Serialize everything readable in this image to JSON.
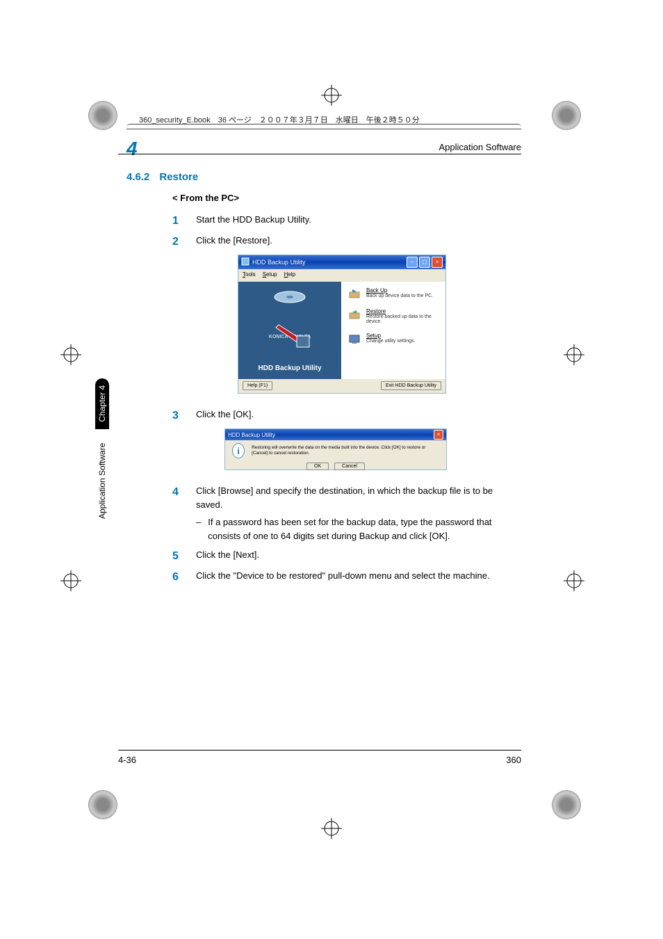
{
  "crop_header": "360_security_E.book　36 ページ　２００７年３月７日　水曜日　午後２時５０分",
  "running_head": {
    "section_number": "4",
    "title": "Application Software"
  },
  "heading": {
    "number": "4.6.2",
    "title": "Restore"
  },
  "subheading": "< From the PC>",
  "steps": {
    "1": "Start the HDD Backup Utility.",
    "2": "Click the [Restore].",
    "3": "Click the [OK].",
    "4": "Click [Browse] and specify the destination, in which the backup file is to be saved.",
    "4_sub": "If a password has been set for the backup data, type the password that consists of one to 64 digits set during Backup and click [OK].",
    "5": "Click the [Next].",
    "6": "Click the \"Device to be restored\" pull-down menu and select the machine."
  },
  "figure1": {
    "title": "HDD Backup Utility",
    "menu": {
      "tools": "Tools",
      "setup": "Setup",
      "help": "Help"
    },
    "logo": "KONICA MINOLTA",
    "utility_label": "HDD Backup Utility",
    "options": {
      "backup": {
        "title": "Back Up",
        "desc": "Back up device data to the PC."
      },
      "restore": {
        "title": "Restore",
        "desc": "Restore backed up data to the device."
      },
      "setup": {
        "title": "Setup",
        "desc": "Change utility settings."
      }
    },
    "buttons": {
      "help": "Help (F1)",
      "exit": "Exit HDD Backup Utility"
    }
  },
  "figure2": {
    "title": "HDD Backup Utility",
    "message": "Restoring will overwrite the data on the media built into the device. Click [OK] to restore or [Cancel] to cancel restoration.",
    "ok": "OK",
    "cancel": "Cancel"
  },
  "side_tab": {
    "label": "Application Software",
    "chapter": "Chapter 4"
  },
  "footer": {
    "left": "4-36",
    "right": "360"
  }
}
